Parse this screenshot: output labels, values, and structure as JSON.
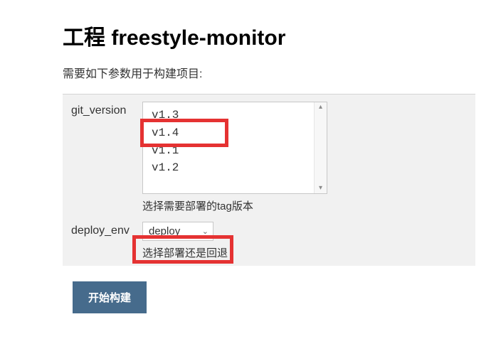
{
  "header": {
    "title": "工程 freestyle-monitor",
    "subtitle": "需要如下参数用于构建项目:"
  },
  "params": {
    "git_version": {
      "label": "git_version",
      "options": [
        "v1.3",
        "v1.4",
        "v1.1",
        "v1.2"
      ],
      "helper": "选择需要部署的tag版本"
    },
    "deploy_env": {
      "label": "deploy_env",
      "selected": "deploy",
      "helper": "选择部署还是回退"
    }
  },
  "actions": {
    "submit_label": "开始构建"
  }
}
